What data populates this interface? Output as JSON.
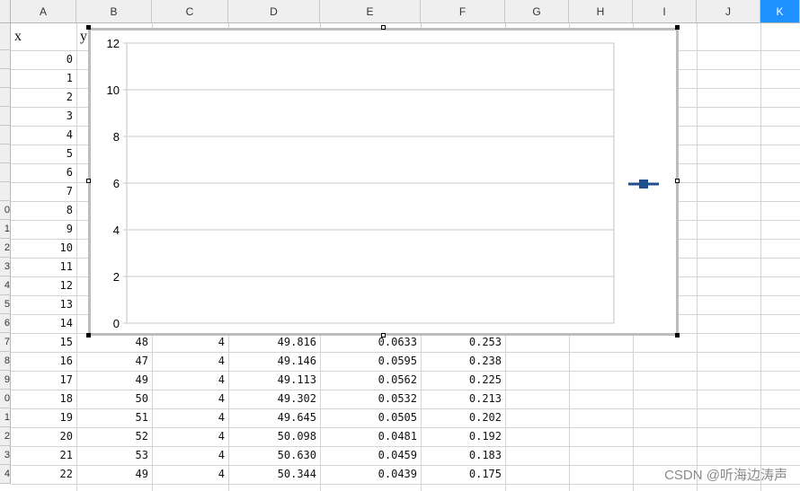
{
  "columns": [
    "A",
    "B",
    "C",
    "D",
    "E",
    "F",
    "G",
    "H",
    "I",
    "J",
    "K"
  ],
  "active_column": "K",
  "row_numbers": [
    "",
    "",
    "",
    "",
    "",
    "",
    "",
    "0",
    "1",
    "2",
    "3",
    "4",
    "5",
    "6",
    "7",
    "8",
    "9",
    "0",
    "1",
    "2",
    "3",
    "4"
  ],
  "header_row": {
    "a": "x",
    "b": "y"
  },
  "x_values": [
    "0",
    "1",
    "2",
    "3",
    "4",
    "5",
    "6",
    "7",
    "8",
    "9",
    "10",
    "11",
    "12",
    "13",
    "14",
    "15",
    "16",
    "17",
    "18",
    "19",
    "20",
    "21",
    "22"
  ],
  "visible_rows": [
    {
      "a": "15",
      "b": "48",
      "c": "4",
      "d": "49.816",
      "e": "0.0633",
      "f": "0.253"
    },
    {
      "a": "16",
      "b": "47",
      "c": "4",
      "d": "49.146",
      "e": "0.0595",
      "f": "0.238"
    },
    {
      "a": "17",
      "b": "49",
      "c": "4",
      "d": "49.113",
      "e": "0.0562",
      "f": "0.225"
    },
    {
      "a": "18",
      "b": "50",
      "c": "4",
      "d": "49.302",
      "e": "0.0532",
      "f": "0.213"
    },
    {
      "a": "19",
      "b": "51",
      "c": "4",
      "d": "49.645",
      "e": "0.0505",
      "f": "0.202"
    },
    {
      "a": "20",
      "b": "52",
      "c": "4",
      "d": "50.098",
      "e": "0.0481",
      "f": "0.192"
    },
    {
      "a": "21",
      "b": "53",
      "c": "4",
      "d": "50.630",
      "e": "0.0459",
      "f": "0.183"
    },
    {
      "a": "22",
      "b": "49",
      "c": "4",
      "d": "50.344",
      "e": "0.0439",
      "f": "0.175"
    }
  ],
  "chart_data": {
    "type": "line",
    "title": "",
    "xlabel": "",
    "ylabel": "",
    "ylim": [
      0,
      12
    ],
    "yticks": [
      "0",
      "2",
      "4",
      "6",
      "8",
      "10",
      "12"
    ],
    "grid": true,
    "legend": "right",
    "series": [
      {
        "values": []
      }
    ],
    "series_color": "#1f4e8c"
  },
  "watermark": "CSDN @听海边涛声"
}
